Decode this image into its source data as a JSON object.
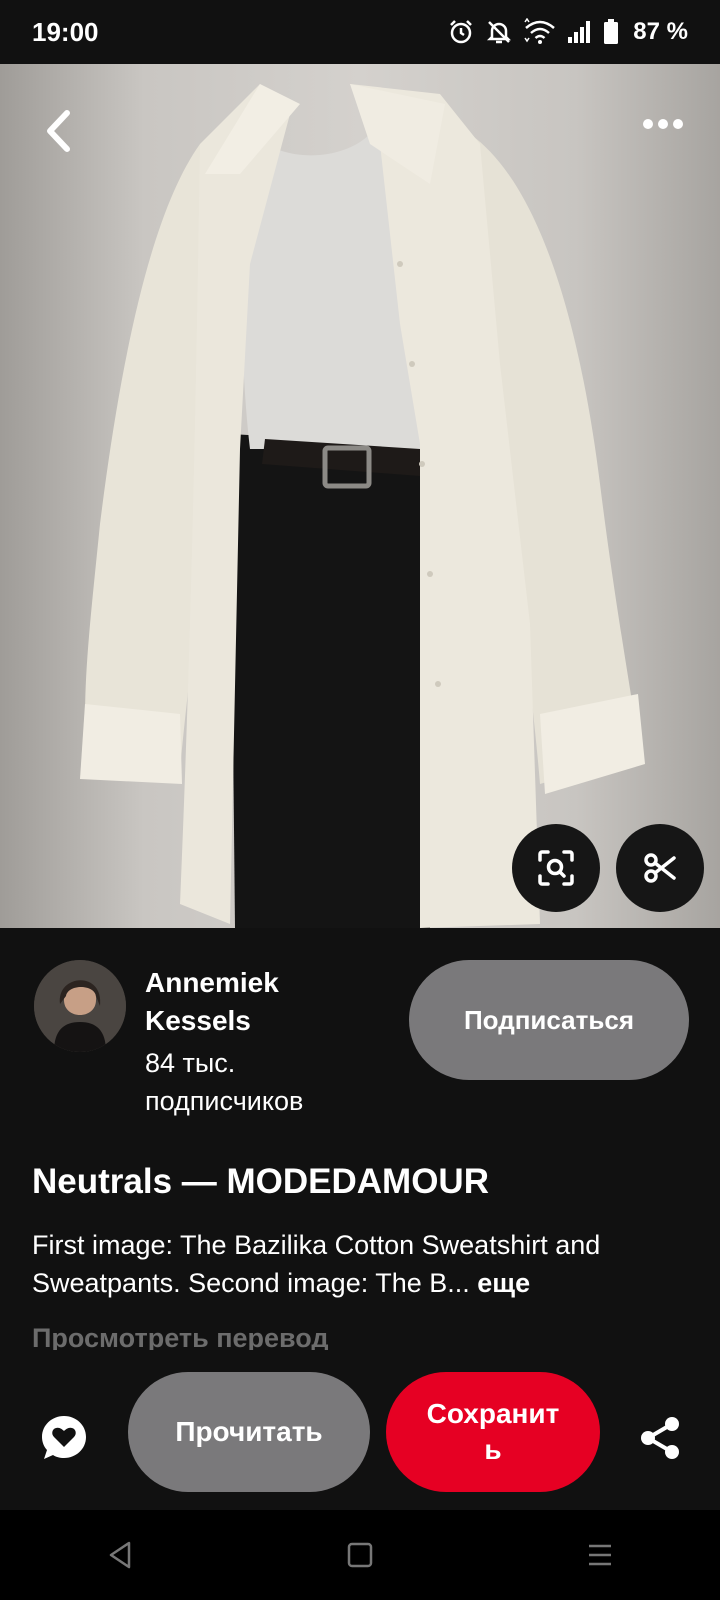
{
  "status_bar": {
    "time": "19:00",
    "battery": "87 %",
    "icons": [
      "alarm-icon",
      "bell-off-icon",
      "wifi-icon",
      "signal-icon",
      "battery-icon"
    ]
  },
  "pin": {
    "image_description_icon": "photo",
    "title": "Neutrals — MODEDAMOUR",
    "description": "First image: The Bazilika Cotton Sweatshirt and Sweatpants. Second image: The B...",
    "more_label": "еще",
    "translate_label": "Просмотреть перевод"
  },
  "author": {
    "name": "Annemiek Kessels",
    "followers": "84 тыс. подписчиков",
    "follow_label": "Подписаться"
  },
  "actions": {
    "read_label": "Прочитать",
    "save_label": "Сохранить"
  },
  "colors": {
    "background": "#111111",
    "save_red": "#e60023",
    "secondary_button": "#7a797b"
  }
}
